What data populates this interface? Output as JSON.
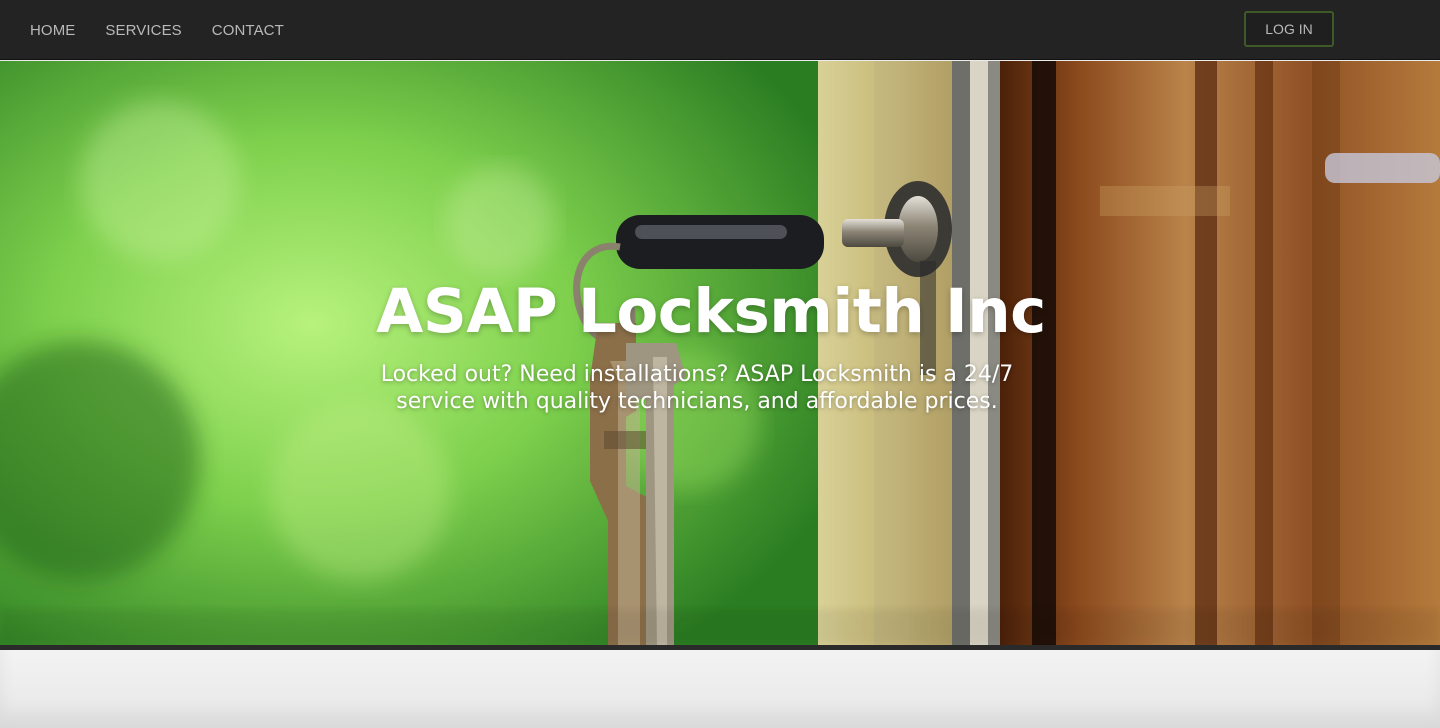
{
  "nav": {
    "items": [
      {
        "label": "HOME"
      },
      {
        "label": "SERVICES"
      },
      {
        "label": "CONTACT"
      }
    ],
    "login_label": "LOG IN"
  },
  "hero": {
    "title": "ASAP Locksmith Inc",
    "subtitle": "Locked out? Need installations? ASAP Locksmith is a 24/7 service with quality technicians, and affordable prices.",
    "image": "key-in-door-lock-photo"
  },
  "colors": {
    "navbar_bg": "#232323",
    "nav_text": "#b9b9b9",
    "login_border": "#3f5a28",
    "hero_green": "#7fcf4c",
    "door_wood": "#6b3a17"
  }
}
